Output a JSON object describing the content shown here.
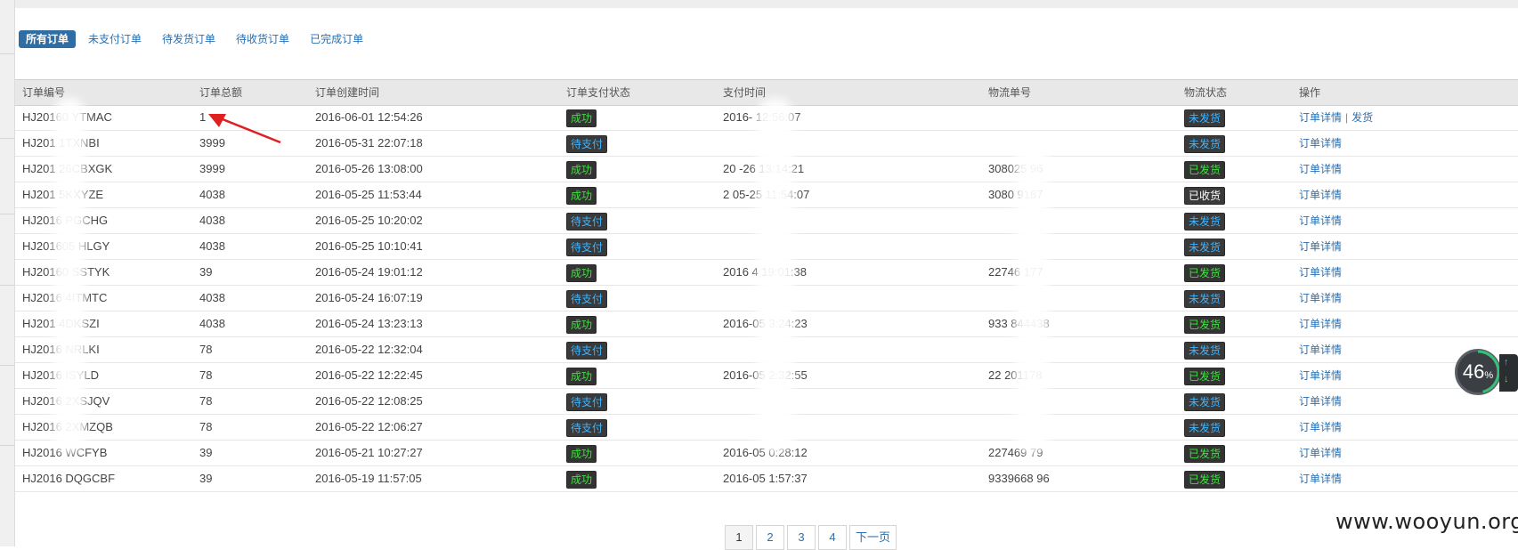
{
  "tabs": [
    "所有订单",
    "未支付订单",
    "待发货订单",
    "待收货订单",
    "已完成订单"
  ],
  "columns": [
    "订单编号",
    "订单总额",
    "订单创建时间",
    "订单支付状态",
    "支付时间",
    "物流单号",
    "物流状态",
    "操作"
  ],
  "rows": [
    {
      "id": "HJ20160  YTMAC",
      "amount": "1",
      "created": "2016-06-01 12:54:26",
      "pay_status": "成功",
      "paid_time": "2016-   12:56:07",
      "tracking": "",
      "ship_status": "未发货",
      "op_detail": "订单详情",
      "op_ship": "发货"
    },
    {
      "id": "HJ201   1TXNBI",
      "amount": "3999",
      "created": "2016-05-31 22:07:18",
      "pay_status": "待支付",
      "paid_time": "",
      "tracking": "",
      "ship_status": "未发货",
      "op_detail": "订单详情",
      "op_ship": ""
    },
    {
      "id": "HJ201  26CBXGK",
      "amount": "3999",
      "created": "2016-05-26 13:08:00",
      "pay_status": "成功",
      "paid_time": "20  -26 13:14:21",
      "tracking": "308025   96",
      "ship_status": "已发货",
      "op_detail": "订单详情",
      "op_ship": ""
    },
    {
      "id": "HJ201  5KXYZE",
      "amount": "4038",
      "created": "2016-05-25 11:53:44",
      "pay_status": "成功",
      "paid_time": "2  05-25 11:54:07",
      "tracking": "3080   9187",
      "ship_status": "已收货",
      "op_detail": "订单详情",
      "op_ship": ""
    },
    {
      "id": "HJ2016  PGCHG",
      "amount": "4038",
      "created": "2016-05-25 10:20:02",
      "pay_status": "待支付",
      "paid_time": "",
      "tracking": "",
      "ship_status": "未发货",
      "op_detail": "订单详情",
      "op_ship": ""
    },
    {
      "id": "HJ201605  HLGY",
      "amount": "4038",
      "created": "2016-05-25 10:10:41",
      "pay_status": "待支付",
      "paid_time": "",
      "tracking": "",
      "ship_status": "未发货",
      "op_detail": "订单详情",
      "op_ship": ""
    },
    {
      "id": "HJ20160  SSTYK",
      "amount": "39",
      "created": "2016-05-24 19:01:12",
      "pay_status": "成功",
      "paid_time": "2016  4 19:01:38",
      "tracking": "22746   177",
      "ship_status": "已发货",
      "op_detail": "订单详情",
      "op_ship": ""
    },
    {
      "id": "HJ2016  4ITMTC",
      "amount": "4038",
      "created": "2016-05-24 16:07:19",
      "pay_status": "待支付",
      "paid_time": "",
      "tracking": "",
      "ship_status": "未发货",
      "op_detail": "订单详情",
      "op_ship": ""
    },
    {
      "id": "HJ201  4DKSZI",
      "amount": "4038",
      "created": "2016-05-24 13:23:13",
      "pay_status": "成功",
      "paid_time": "2016-05  3:24:23",
      "tracking": "933  844438",
      "ship_status": "已发货",
      "op_detail": "订单详情",
      "op_ship": ""
    },
    {
      "id": "HJ2016  NRLKI",
      "amount": "78",
      "created": "2016-05-22 12:32:04",
      "pay_status": "待支付",
      "paid_time": "",
      "tracking": "",
      "ship_status": "未发货",
      "op_detail": "订单详情",
      "op_ship": ""
    },
    {
      "id": "HJ2016  ISYLD",
      "amount": "78",
      "created": "2016-05-22 12:22:45",
      "pay_status": "成功",
      "paid_time": "2016-05  2:32:55",
      "tracking": "22  201178",
      "ship_status": "已发货",
      "op_detail": "订单详情",
      "op_ship": ""
    },
    {
      "id": "HJ2016  2XSJQV",
      "amount": "78",
      "created": "2016-05-22 12:08:25",
      "pay_status": "待支付",
      "paid_time": "",
      "tracking": "",
      "ship_status": "未发货",
      "op_detail": "订单详情",
      "op_ship": ""
    },
    {
      "id": "HJ2016  2XMZQB",
      "amount": "78",
      "created": "2016-05-22 12:06:27",
      "pay_status": "待支付",
      "paid_time": "",
      "tracking": "",
      "ship_status": "未发货",
      "op_detail": "订单详情",
      "op_ship": ""
    },
    {
      "id": "HJ2016  WCFYB",
      "amount": "39",
      "created": "2016-05-21 10:27:27",
      "pay_status": "成功",
      "paid_time": "2016-05  0:28:12",
      "tracking": "227469  79",
      "ship_status": "已发货",
      "op_detail": "订单详情",
      "op_ship": ""
    },
    {
      "id": "HJ2016  DQGCBF",
      "amount": "39",
      "created": "2016-05-19 11:57:05",
      "pay_status": "成功",
      "paid_time": "2016-05  1:57:37",
      "tracking": "9339668  96",
      "ship_status": "已发货",
      "op_detail": "订单详情",
      "op_ship": ""
    }
  ],
  "badge_colors": {
    "成功": {
      "bg": "#333333",
      "fg": "#40e040"
    },
    "待支付": {
      "bg": "#3a3a3a",
      "fg": "#3fb4ff"
    },
    "未发货": {
      "bg": "#3a3a3a",
      "fg": "#3fb4ff"
    },
    "已发货": {
      "bg": "#333333",
      "fg": "#40e040"
    },
    "已收货": {
      "bg": "#3a3a3a",
      "fg": "#ffffff"
    }
  },
  "pagination": {
    "pages": [
      "1",
      "2",
      "3",
      "4"
    ],
    "current": "1",
    "next_label": "下一页"
  },
  "widget": {
    "value": "46",
    "unit": "%"
  },
  "watermark": "www.wooyun.org",
  "annotation_color": "#e02020"
}
